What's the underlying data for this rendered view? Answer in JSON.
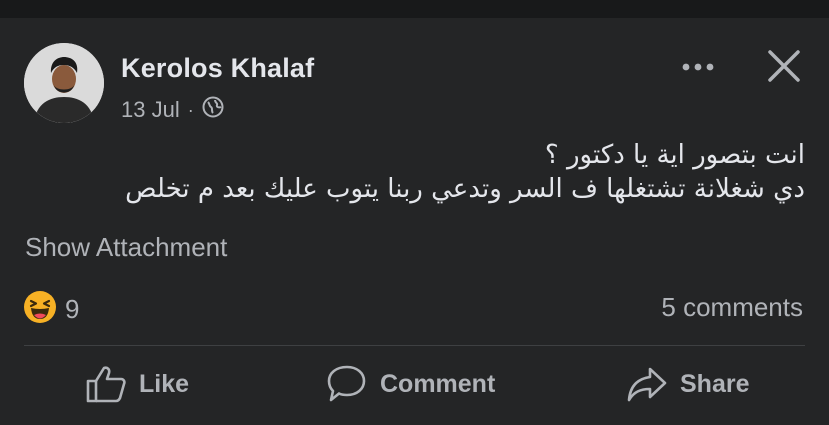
{
  "post": {
    "author": "Kerolos Khalaf",
    "date": "13 Jul",
    "separator": "·",
    "privacy_icon": "globe-icon",
    "more_icon": "more-options-icon",
    "close_icon": "close-icon",
    "text_lines": [
      "انت بتصور اية يا دكتور ؟",
      "دي شغلانة تشتغلها ف السر وتدعي ربنا يتوب عليك بعد م تخلص"
    ],
    "attachment_label": "Show Attachment"
  },
  "reactions": {
    "icon": "haha-emoji-icon",
    "count": "9",
    "comments_label": "5 comments"
  },
  "actions": {
    "like_label": "Like",
    "comment_label": "Comment",
    "share_label": "Share"
  },
  "colors": {
    "background": "#18191a",
    "card": "#242526",
    "primary_text": "#e4e6eb",
    "secondary_text": "#b0b3b8",
    "divider": "#3e4042",
    "haha_yellow": "#f7b125"
  }
}
